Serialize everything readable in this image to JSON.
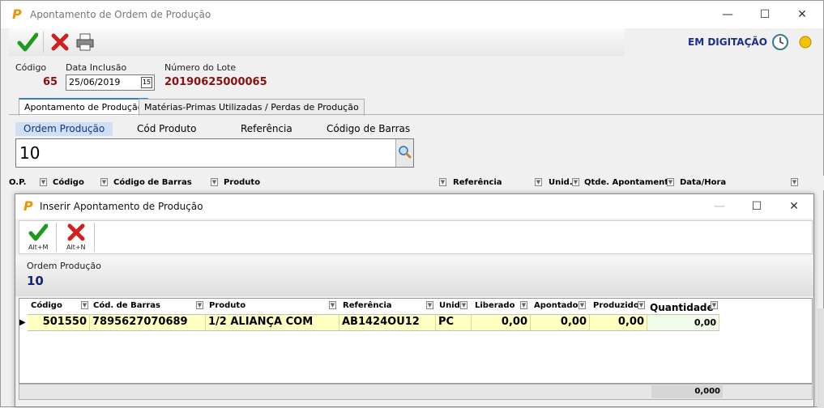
{
  "window": {
    "title": "Apontamento de Ordem de Produção",
    "status": "EM DIGITAÇÃO"
  },
  "header": {
    "codigo_label": "Código",
    "codigo_value": "65",
    "data_label": "Data Inclusão",
    "data_value": "25/06/2019",
    "lote_label": "Número do Lote",
    "lote_value": "20190625000065"
  },
  "tabs": [
    {
      "label": "Apontamento de Produção",
      "active": true
    },
    {
      "label": "Matérias-Primas Utilizadas / Perdas de Produção",
      "active": false
    }
  ],
  "search": {
    "tabs": [
      "Ordem Produção",
      "Cód Produto",
      "Referência",
      "Código de Barras"
    ],
    "value": "10"
  },
  "main_grid": {
    "columns": [
      "O.P.",
      "Código",
      "Código de Barras",
      "Produto",
      "Referência",
      "Unid.",
      "Qtde. Apontamento",
      "Data/Hora"
    ]
  },
  "dialog": {
    "title": "Inserir Apontamento de Produção",
    "confirm_shortcut": "Alt+M",
    "cancel_shortcut": "Alt+N",
    "ordem_label": "Ordem Produção",
    "ordem_value": "10",
    "columns": [
      "Código",
      "Cód. de Barras",
      "Produto",
      "Referência",
      "Unid.",
      "Liberado",
      "Apontado",
      "Produzido",
      "Quantidade"
    ],
    "rows": [
      {
        "codigo": "501550",
        "barras": "7895627070689",
        "produto": "1/2 ALIANÇA COM",
        "referencia": "AB1424OU12",
        "unid": "PC",
        "liberado": "0,00",
        "apontado": "0,00",
        "produzido": "0,00",
        "quantidade": "0,00"
      }
    ],
    "footer_total": "0,000"
  }
}
